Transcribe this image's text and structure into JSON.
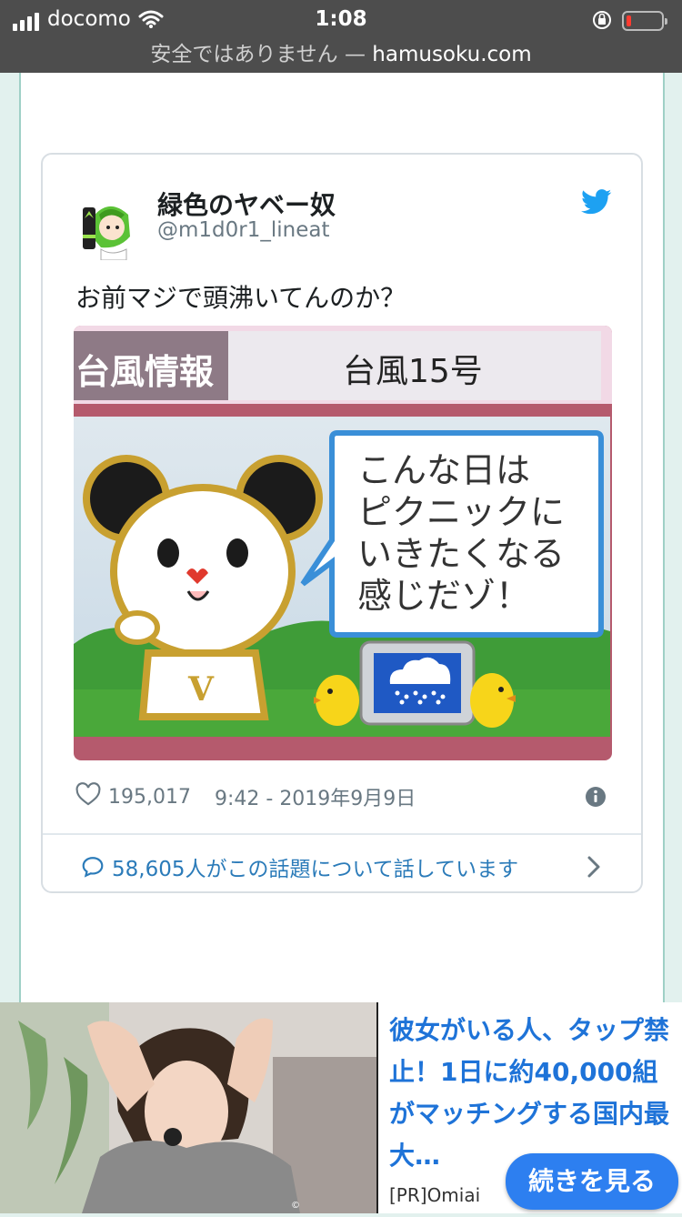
{
  "status_bar": {
    "carrier": "docomo",
    "time": "1:08",
    "battery_level": 0.15
  },
  "url_bar": {
    "security_text": "安全ではありません — ",
    "host": "hamusoku.com"
  },
  "tweet": {
    "display_name": "緑色のヤベー奴",
    "handle": "@m1d0r1_lineat",
    "text": "お前マジで頭沸いてんのか？",
    "image": {
      "header_left": "台風情報",
      "header_right": "台風15号",
      "speech_lines": [
        "こんな日は",
        "ピクニックに",
        "いきたくなる",
        "感じだゾ！"
      ],
      "mascot_letter": "V"
    },
    "like_count": "195,017",
    "timestamp": "9:42 - 2019年9月9日",
    "conversation_text": "58,605人がこの話題について話しています"
  },
  "ad": {
    "title": "彼女がいる人、タップ禁止！1日に約40,000組がマッチングする国内最大…",
    "sponsor": "[PR]Omiai",
    "cta": "続きを見る"
  },
  "colors": {
    "link_blue": "#2b7bb9",
    "twitter_blue": "#1da1f2",
    "ad_blue": "#1e73d8",
    "cta_blue": "#2d7ff0"
  }
}
